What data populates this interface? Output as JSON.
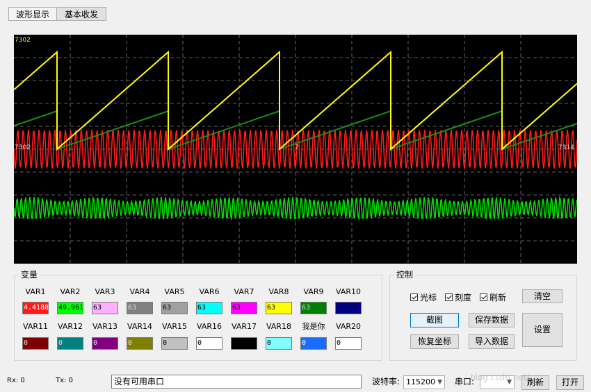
{
  "tabs": [
    {
      "label": "波形显示",
      "active": true
    },
    {
      "label": "基本收发",
      "active": false
    }
  ],
  "scope": {
    "label_top_left": "7302",
    "label_mid_left": "7302",
    "label_mid_right": "7314",
    "label_mid_small": "7",
    "colors": {
      "background": "#000000",
      "grid": "#808080",
      "yellow": "#ffff00",
      "red": "#ff1a1a",
      "green": "#00dd00",
      "dark_green": "#1a8f1a"
    }
  },
  "variables": {
    "title": "变量",
    "row1": [
      {
        "label": "VAR1",
        "value": "4.4188",
        "color": "#ff1a1a"
      },
      {
        "label": "VAR2",
        "value": "49.961",
        "color": "#00ff00"
      },
      {
        "label": "VAR3",
        "value": "63",
        "color": "#ffb0ff"
      },
      {
        "label": "VAR4",
        "value": "63",
        "color": "#808080"
      },
      {
        "label": "VAR5",
        "value": "63",
        "color": "#a0a0a0"
      },
      {
        "label": "VAR6",
        "value": "63",
        "color": "#00ffff"
      },
      {
        "label": "VAR7",
        "value": "63",
        "color": "#ff00ff"
      },
      {
        "label": "VAR8",
        "value": "63",
        "color": "#ffff00"
      },
      {
        "label": "VAR9",
        "value": "63",
        "color": "#008000"
      },
      {
        "label": "VAR10",
        "value": "",
        "color": "#000080"
      }
    ],
    "row2": [
      {
        "label": "VAR11",
        "value": "0",
        "color": "#800000"
      },
      {
        "label": "VAR12",
        "value": "0",
        "color": "#008080"
      },
      {
        "label": "VAR13",
        "value": "0",
        "color": "#800080"
      },
      {
        "label": "VAR14",
        "value": "0",
        "color": "#808000"
      },
      {
        "label": "VAR15",
        "value": "0",
        "color": "#c0c0c0"
      },
      {
        "label": "VAR16",
        "value": "0",
        "color": "#ffffff"
      },
      {
        "label": "VAR17",
        "value": "",
        "color": "#000000"
      },
      {
        "label": "VAR18",
        "value": "0",
        "color": "#80ffff"
      },
      {
        "label": "我是你",
        "value": "0",
        "color": "#1a6cff"
      },
      {
        "label": "VAR20",
        "value": "0",
        "color": "#ffffff"
      }
    ]
  },
  "control": {
    "title": "控制",
    "checkboxes": [
      {
        "label": "光标",
        "checked": true
      },
      {
        "label": "刻度",
        "checked": true
      },
      {
        "label": "刷新",
        "checked": true
      }
    ],
    "clear_label": "清空",
    "screenshot_label": "截图",
    "save_label": "保存数据",
    "restore_label": "恢复坐标",
    "import_label": "导入数据",
    "settings_label": "设置"
  },
  "statusbar": {
    "rx": "Rx: 0",
    "tx": "Tx: 0",
    "message": "没有可用串口",
    "baud_label": "波特率:",
    "baud_value": "115200",
    "port_label": "串口:",
    "port_value": "",
    "refresh_label": "刷新",
    "open_label": "打开",
    "watermark": "blog.csdn.net/..."
  }
}
